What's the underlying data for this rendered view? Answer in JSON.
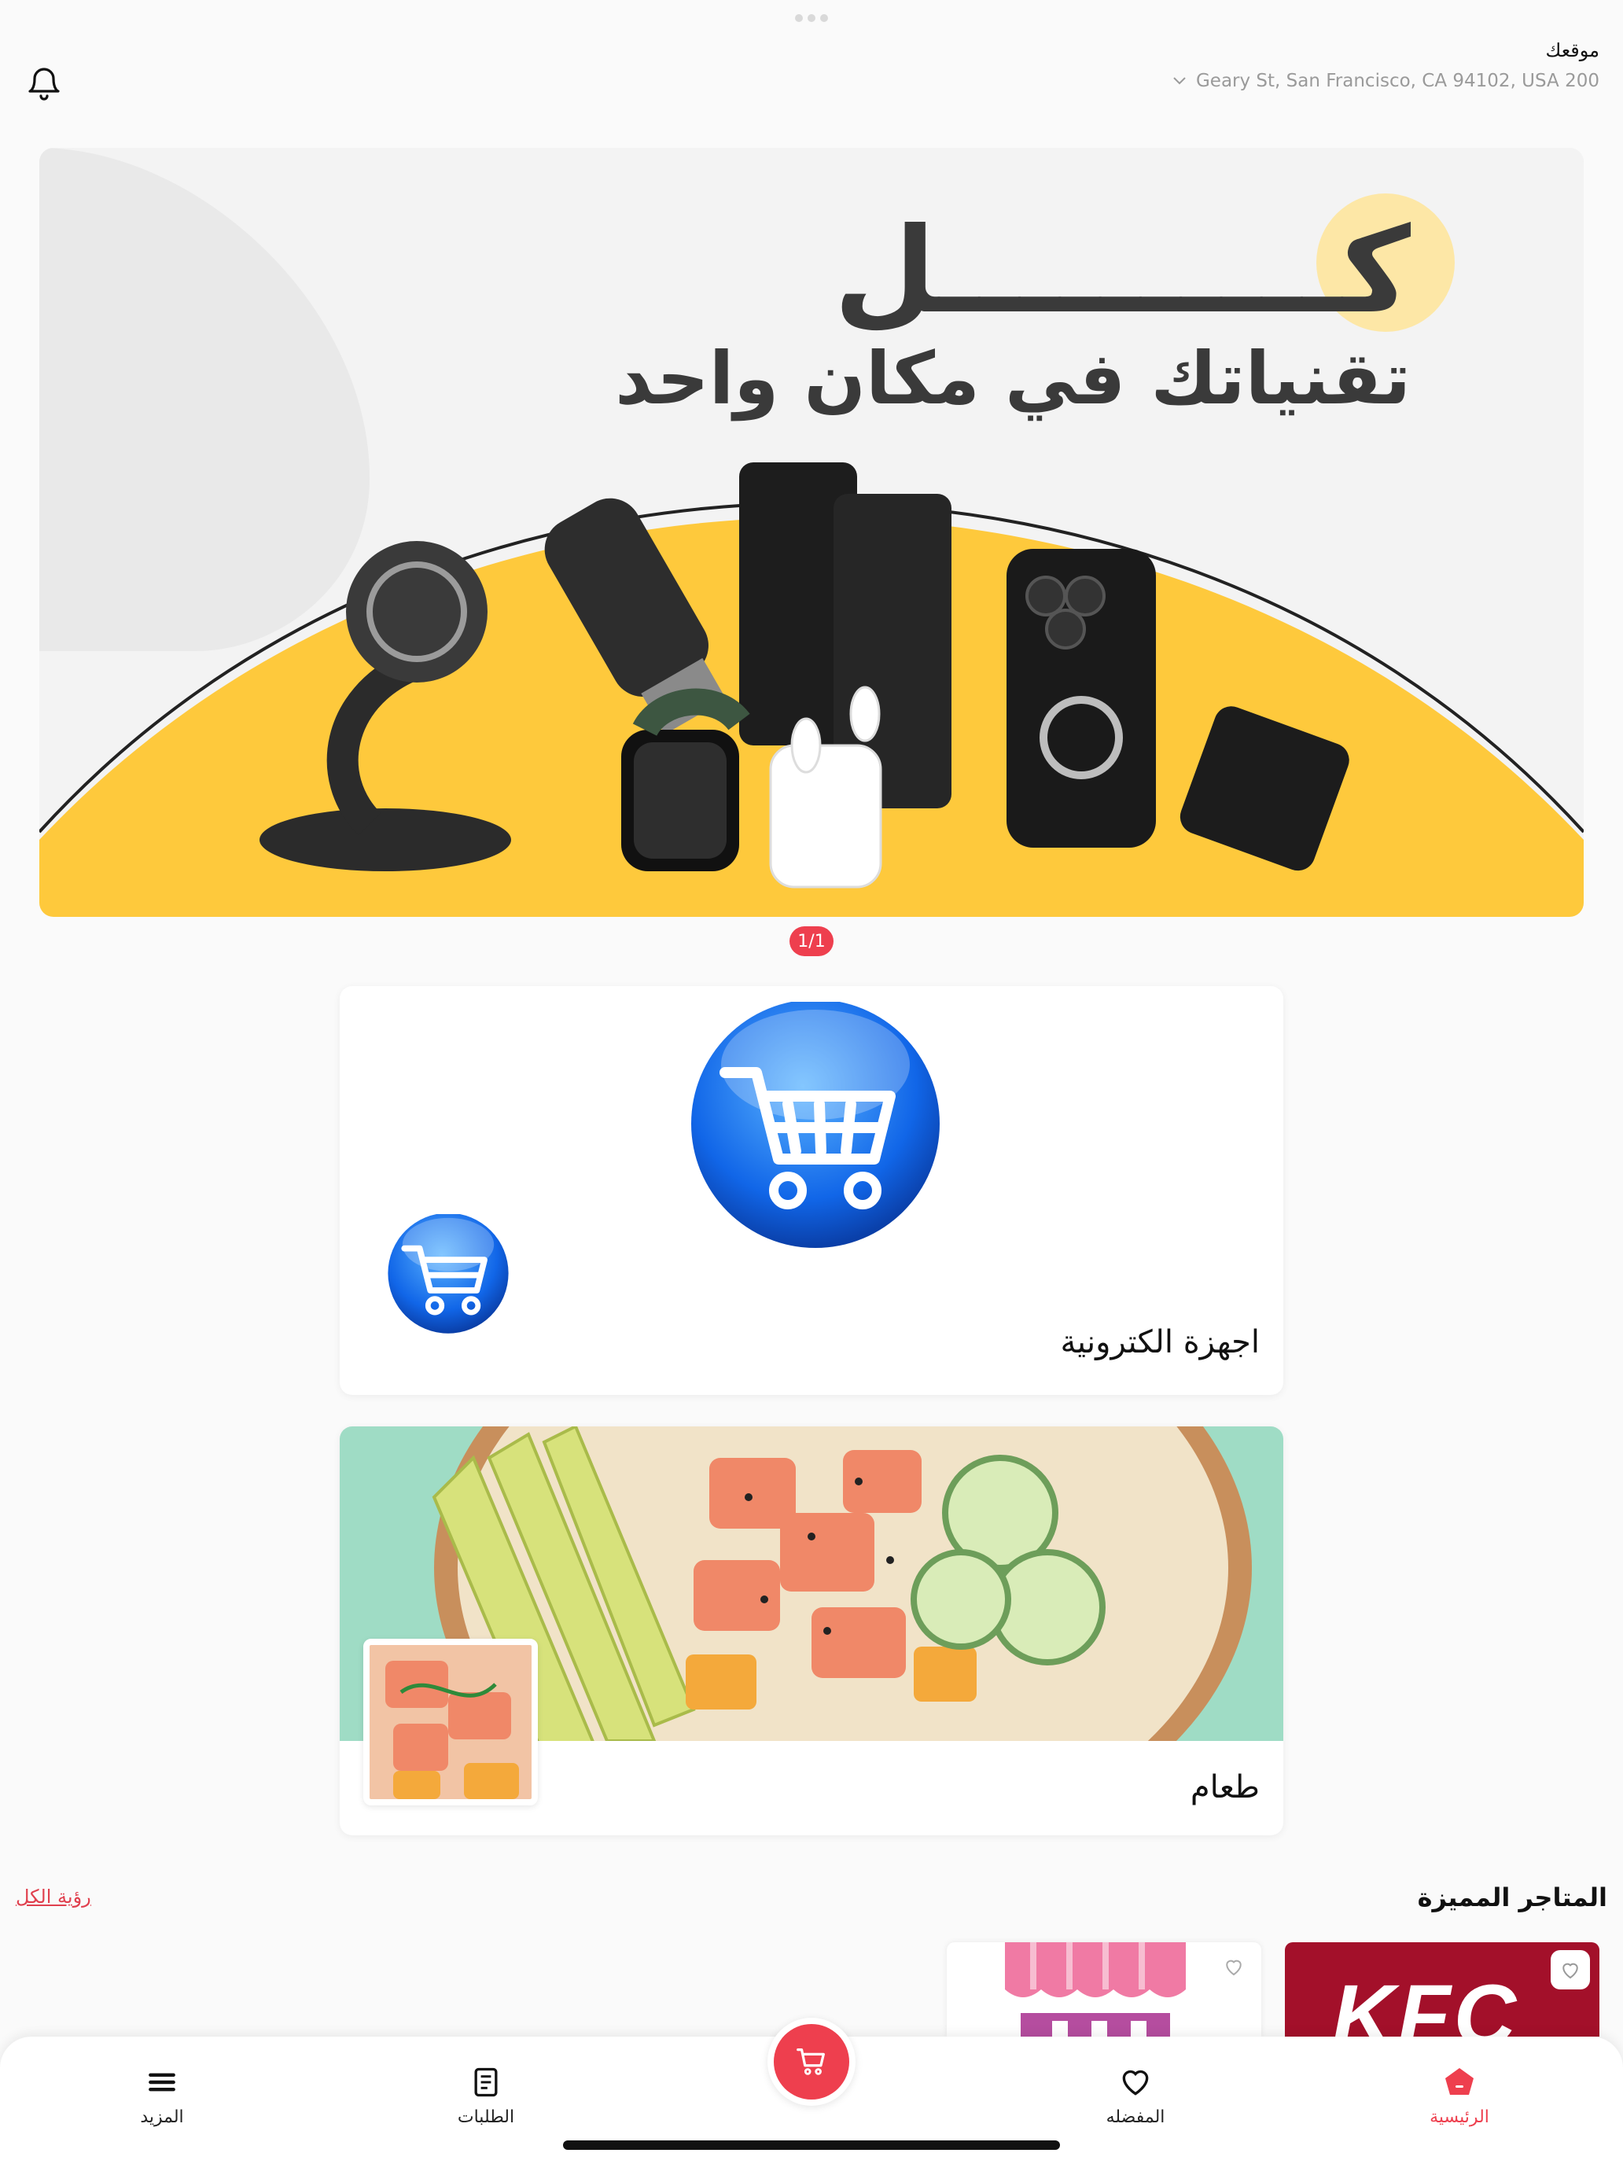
{
  "header": {
    "location_label": "موقعك",
    "address": "Geary St, San Francisco, CA 94102, USA 200",
    "icons": {
      "notifications": "bell-icon",
      "dropdown": "chevron-down-icon"
    }
  },
  "banner": {
    "headline_top": "كــــــــــل",
    "headline": "تقنياتك في مكان واحد",
    "pager": "1/1",
    "accent_color": "#fec93c"
  },
  "categories": [
    {
      "title": "اجهزة الكترونية",
      "icon": "shopping-cart-icon"
    },
    {
      "title": "طعام",
      "icon": "food-bowl-image"
    }
  ],
  "featured": {
    "title": "المتاجر المميزة",
    "see_all": "رؤية الكل",
    "stores": [
      {
        "logo": "KFC",
        "color": "#a3102a"
      },
      {
        "logo": "store-awning-icon",
        "color": "#f07aa4"
      }
    ]
  },
  "bottom_nav": {
    "items": [
      {
        "label": "الرئيسية",
        "icon": "home-icon",
        "active": true
      },
      {
        "label": "المفضله",
        "icon": "heart-icon",
        "active": false
      },
      {
        "label": "الطلبات",
        "icon": "orders-icon",
        "active": false
      },
      {
        "label": "المزيد",
        "icon": "menu-icon",
        "active": false
      }
    ],
    "cart_icon": "cart-icon"
  },
  "colors": {
    "accent": "#ee3f4e",
    "background": "#fafafa"
  }
}
